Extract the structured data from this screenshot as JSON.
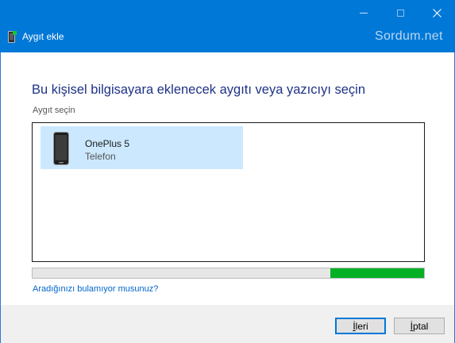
{
  "window": {
    "title": "Aygıt ekle",
    "watermark": "Sordum.net",
    "icon": "device-add-icon"
  },
  "main": {
    "heading": "Bu kişisel bilgisayara eklenecek aygıtı veya yazıcıyı seçin",
    "sublabel": "Aygıt seçin",
    "devices": [
      {
        "name": "OnePlus 5",
        "type": "Telefon",
        "icon": "phone-icon",
        "selected": true
      }
    ],
    "progress_fraction": 0.24,
    "help_link": "Aradığınızı bulamıyor musunuz?"
  },
  "footer": {
    "next_first": "İ",
    "next_rest": "leri",
    "cancel_first": "İ",
    "cancel_rest": "ptal"
  },
  "colors": {
    "titlebar": "#0078d7",
    "heading": "#1e3287",
    "selection": "#cce8ff",
    "progress": "#06b025",
    "link": "#0066cc"
  }
}
